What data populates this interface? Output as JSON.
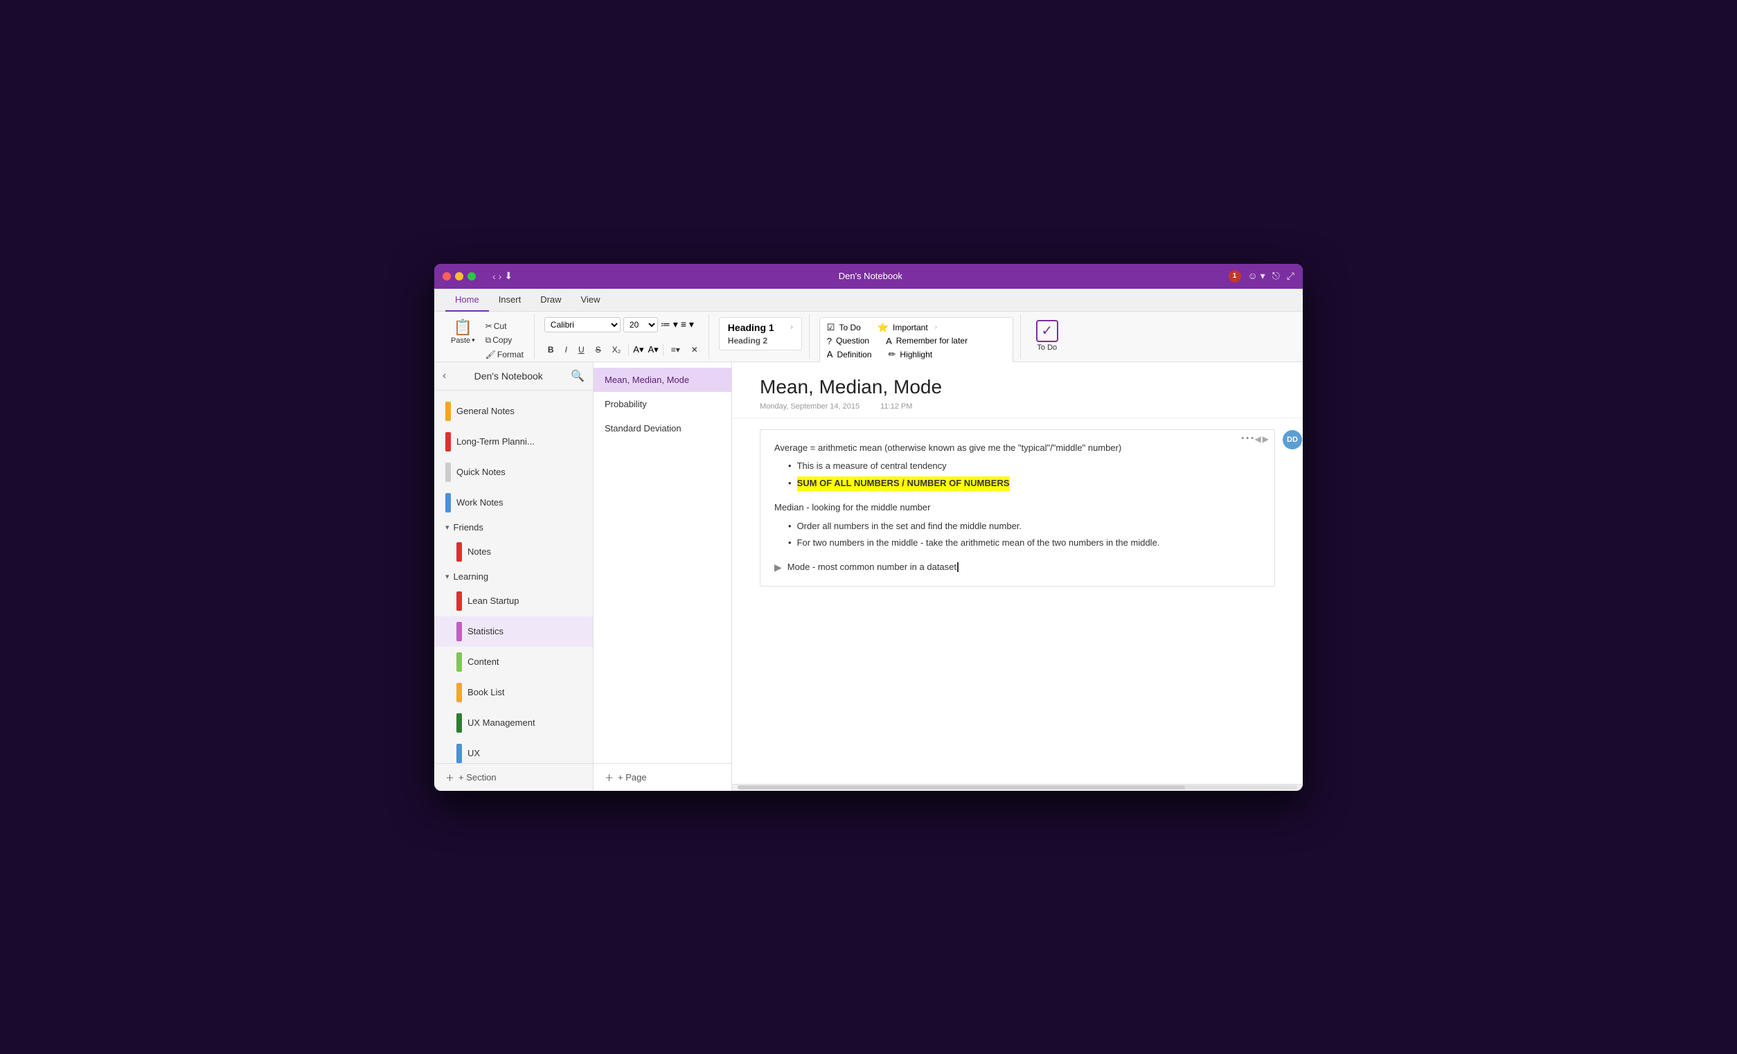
{
  "window": {
    "title": "Den's Notebook"
  },
  "titlebar": {
    "back_label": "‹",
    "forward_label": "›",
    "quick_access_icon": "⬇",
    "notification_count": "1",
    "smiley_icon": "☺",
    "share_icon": "⎋",
    "expand_icon": "⤢"
  },
  "ribbon": {
    "tabs": [
      "Home",
      "Insert",
      "Draw",
      "View"
    ],
    "active_tab": "Home",
    "paste_label": "Paste",
    "cut_label": "Cut",
    "copy_label": "Copy",
    "format_label": "Format",
    "font_family": "Calibri",
    "font_size": "20",
    "bold_label": "B",
    "italic_label": "I",
    "underline_label": "U",
    "strikethrough_label": "S",
    "subscript_label": "X₂",
    "align_label": "≡",
    "clear_label": "✕",
    "styles": {
      "heading1": "Heading 1",
      "heading2": "Heading 2",
      "more_arrow": "›"
    },
    "tags": {
      "todo": "To Do",
      "question": "Question",
      "definition": "Definition",
      "important": "Important",
      "remember": "Remember for later",
      "highlight": "Highlight",
      "more_arrow": "›"
    },
    "todo_label": "To Do"
  },
  "sidebar": {
    "title": "Den's Notebook",
    "sections": [
      {
        "id": "general-notes",
        "label": "General Notes",
        "color": "#f5a623"
      },
      {
        "id": "long-term",
        "label": "Long-Term Planni...",
        "color": "#e03030"
      },
      {
        "id": "quick-notes",
        "label": "Quick Notes",
        "color": "#cccccc"
      },
      {
        "id": "work-notes",
        "label": "Work Notes",
        "color": "#4a90d9"
      }
    ],
    "groups": [
      {
        "id": "friends",
        "label": "Friends",
        "collapsed": false,
        "items": [
          {
            "id": "notes",
            "label": "Notes",
            "color": "#e03030"
          }
        ]
      },
      {
        "id": "learning",
        "label": "Learning",
        "collapsed": false,
        "items": [
          {
            "id": "lean-startup",
            "label": "Lean Startup",
            "color": "#e03030"
          },
          {
            "id": "statistics",
            "label": "Statistics",
            "color": "#c060c0",
            "active": true
          },
          {
            "id": "content",
            "label": "Content",
            "color": "#7ec850"
          },
          {
            "id": "book-list",
            "label": "Book List",
            "color": "#f5a623"
          },
          {
            "id": "ux-management",
            "label": "UX Management",
            "color": "#2e7d32"
          },
          {
            "id": "ux",
            "label": "UX",
            "color": "#4a90d9"
          }
        ]
      }
    ],
    "add_section_label": "+ Section"
  },
  "pages": {
    "items": [
      {
        "id": "mean-median-mode",
        "label": "Mean, Median, Mode",
        "active": true
      },
      {
        "id": "probability",
        "label": "Probability"
      },
      {
        "id": "standard-deviation",
        "label": "Standard Deviation"
      }
    ],
    "add_page_label": "+ Page"
  },
  "note": {
    "title": "Mean, Median, Mode",
    "date": "Monday, September 14, 2015",
    "time": "11:12 PM",
    "avatar": "DD",
    "paragraphs": [
      {
        "id": "p1",
        "text": "Average = arithmetic mean (otherwise known as give me the \"typical\"/\"middle\" number)"
      }
    ],
    "bullets_p1": [
      "This is a measure of central tendency",
      "SUM OF ALL NUMBERS / NUMBER OF NUMBERS"
    ],
    "highlighted_bullet": "SUM OF ALL NUMBERS / NUMBER OF NUMBERS",
    "section2_title": "Median - looking for the middle number",
    "bullets_p2": [
      "Order all numbers in the set and find the middle number.",
      "For two numbers in the middle - take the arithmetic mean of the two numbers in the middle."
    ],
    "mode_text": "Mode - most common number in a dataset"
  }
}
